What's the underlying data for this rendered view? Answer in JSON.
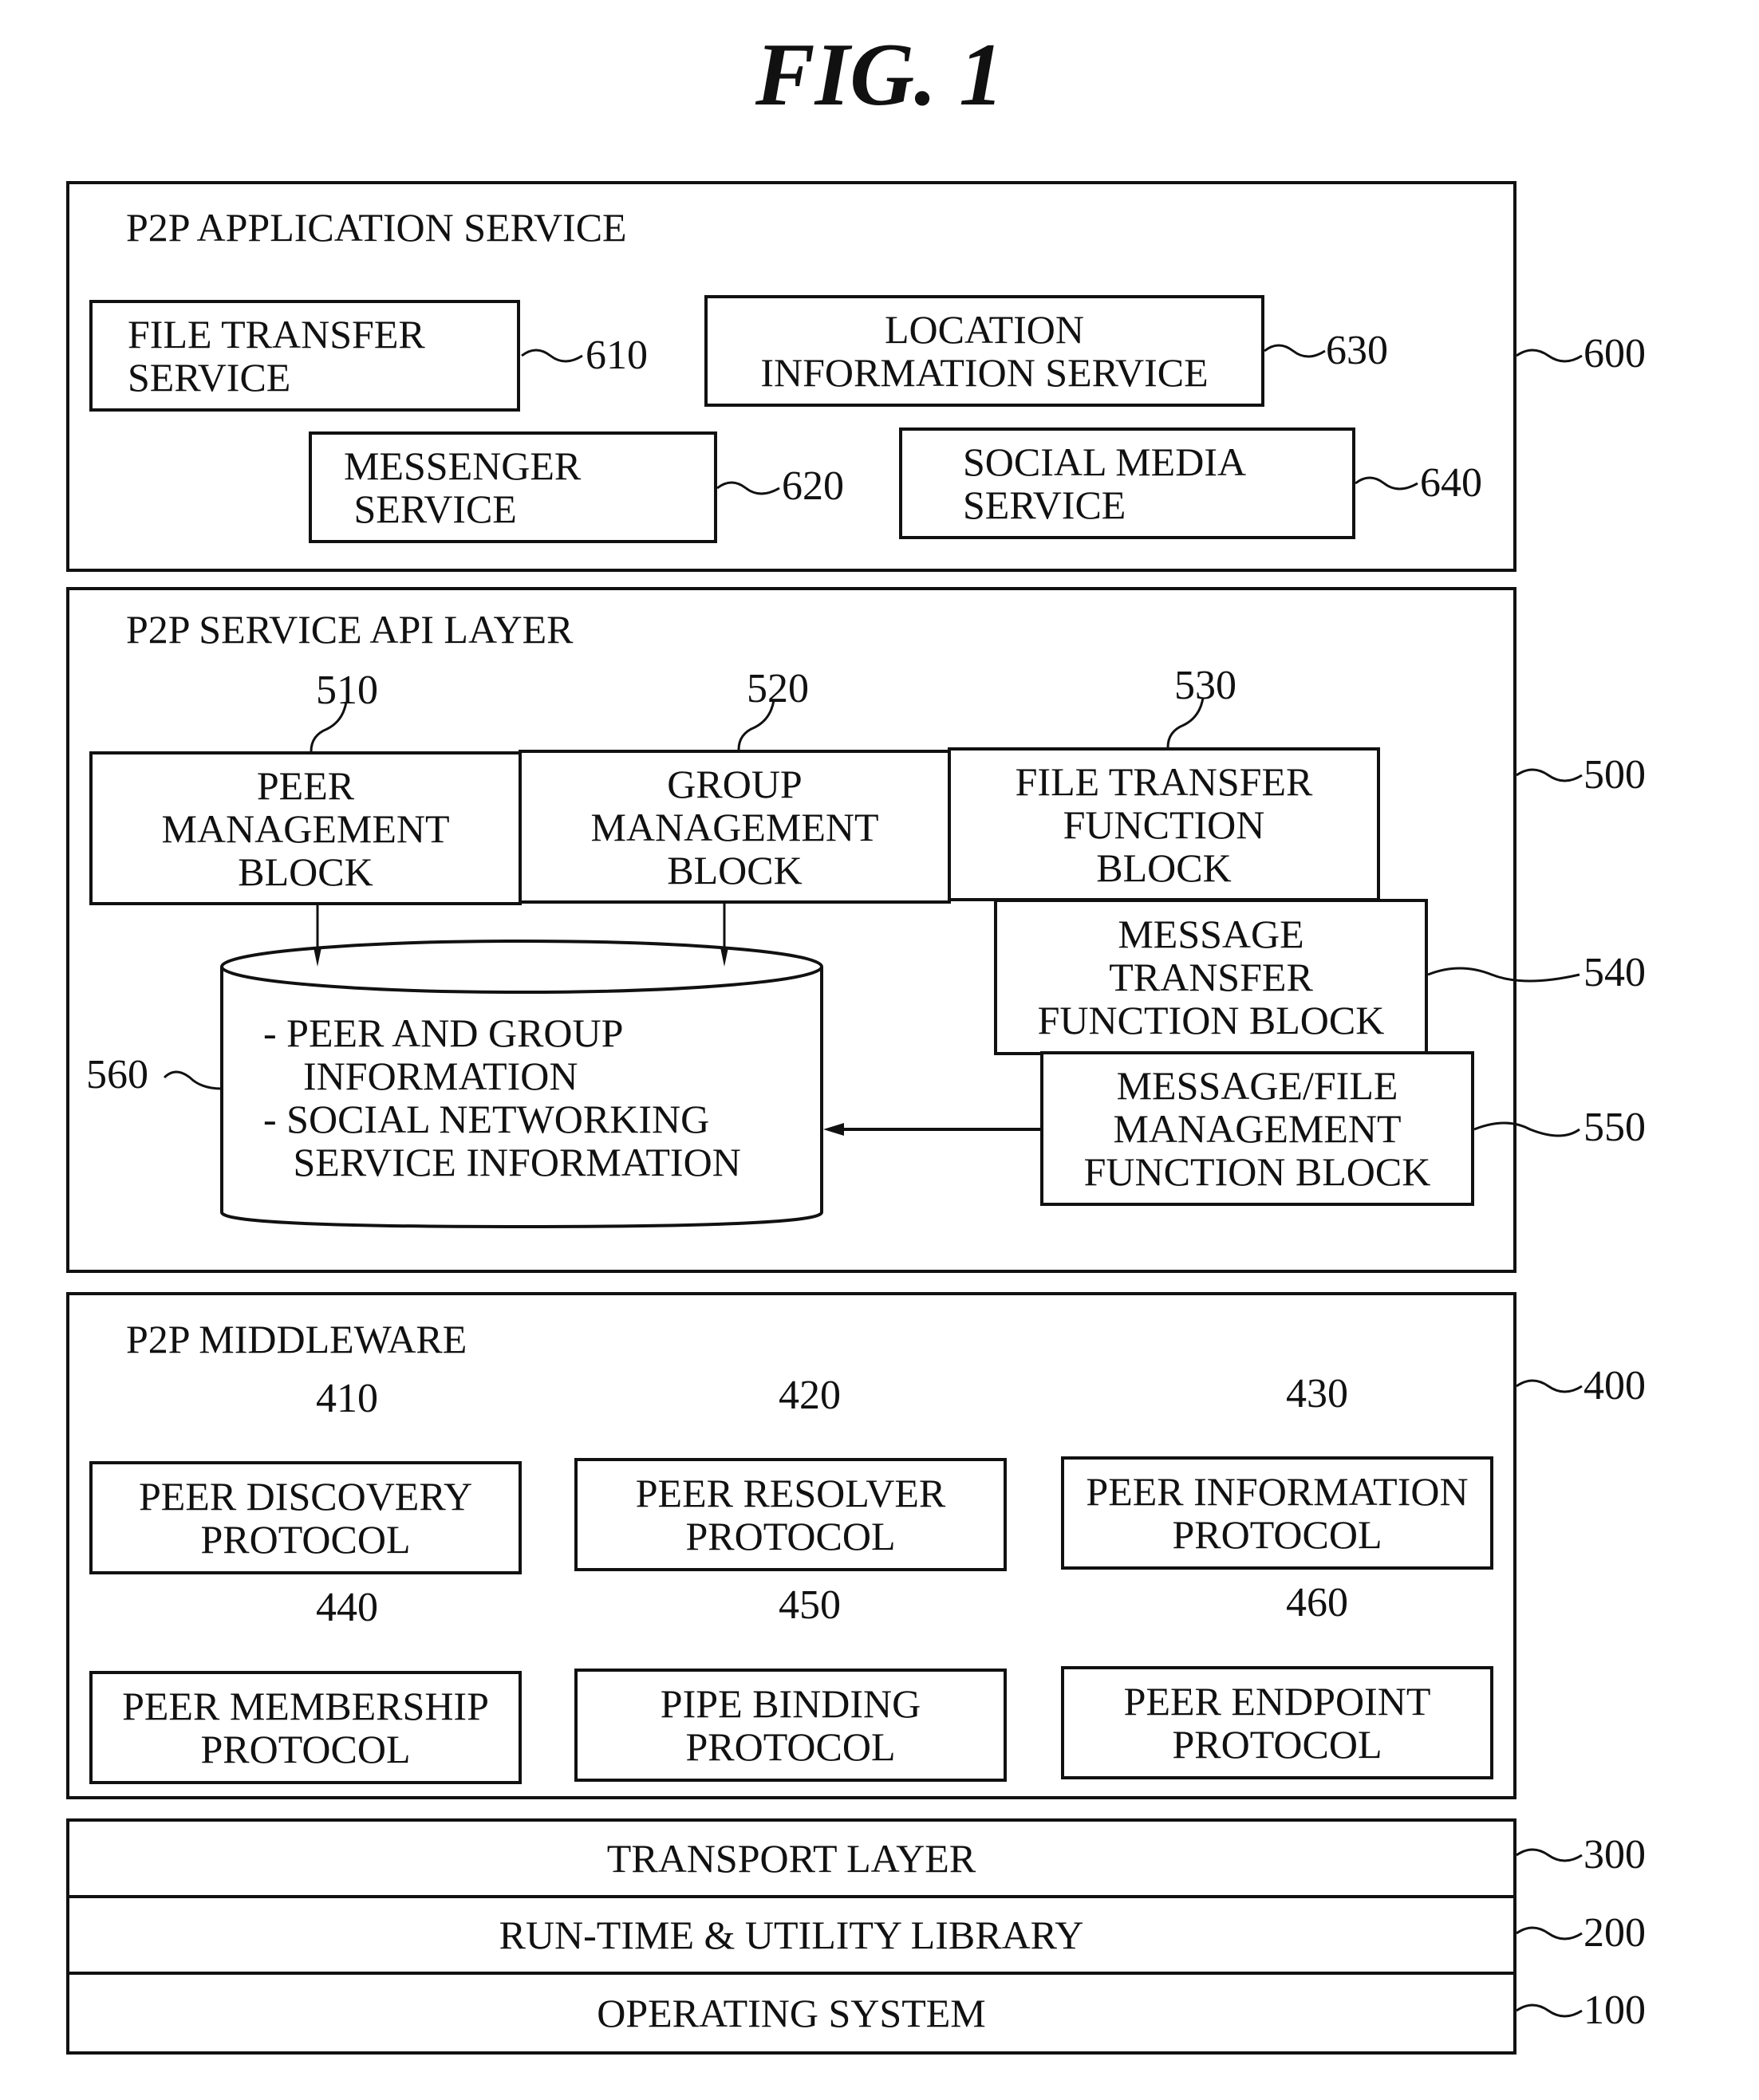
{
  "figure_title": "FIG. 1",
  "layers": {
    "app": {
      "label": "P2P APPLICATION SERVICE",
      "ref": "600",
      "blocks": [
        {
          "text": "FILE TRANSFER\nSERVICE",
          "ref": "610"
        },
        {
          "text": "MESSENGER\n SERVICE",
          "ref": "620"
        },
        {
          "text": "LOCATION\nINFORMATION SERVICE",
          "ref": "630"
        },
        {
          "text": "SOCIAL MEDIA\nSERVICE",
          "ref": "640"
        }
      ]
    },
    "api": {
      "label": "P2P SERVICE API LAYER",
      "ref": "500",
      "blocks": [
        {
          "text": "PEER\nMANAGEMENT\nBLOCK",
          "ref": "510"
        },
        {
          "text": "GROUP\nMANAGEMENT\nBLOCK",
          "ref": "520"
        },
        {
          "text": "FILE TRANSFER\nFUNCTION\nBLOCK",
          "ref": "530"
        },
        {
          "text": "MESSAGE\nTRANSFER\nFUNCTION BLOCK",
          "ref": "540"
        },
        {
          "text": "MESSAGE/FILE\nMANAGEMENT\nFUNCTION BLOCK",
          "ref": "550"
        }
      ],
      "database": {
        "text": "- PEER AND GROUP\n    INFORMATION\n- SOCIAL NETWORKING\n   SERVICE INFORMATION",
        "ref": "560"
      }
    },
    "middleware": {
      "label": "P2P MIDDLEWARE",
      "ref": "400",
      "blocks": [
        {
          "text": "PEER DISCOVERY\nPROTOCOL",
          "ref": "410"
        },
        {
          "text": "PEER RESOLVER\nPROTOCOL",
          "ref": "420"
        },
        {
          "text": "PEER INFORMATION\nPROTOCOL",
          "ref": "430"
        },
        {
          "text": "PEER MEMBERSHIP\nPROTOCOL",
          "ref": "440"
        },
        {
          "text": "PIPE BINDING\nPROTOCOL",
          "ref": "450"
        },
        {
          "text": "PEER ENDPOINT\nPROTOCOL",
          "ref": "460"
        }
      ]
    },
    "transport": {
      "label": "TRANSPORT LAYER",
      "ref": "300"
    },
    "runtime": {
      "label": "RUN-TIME & UTILITY LIBRARY",
      "ref": "200"
    },
    "os": {
      "label": "OPERATING SYSTEM",
      "ref": "100"
    }
  }
}
